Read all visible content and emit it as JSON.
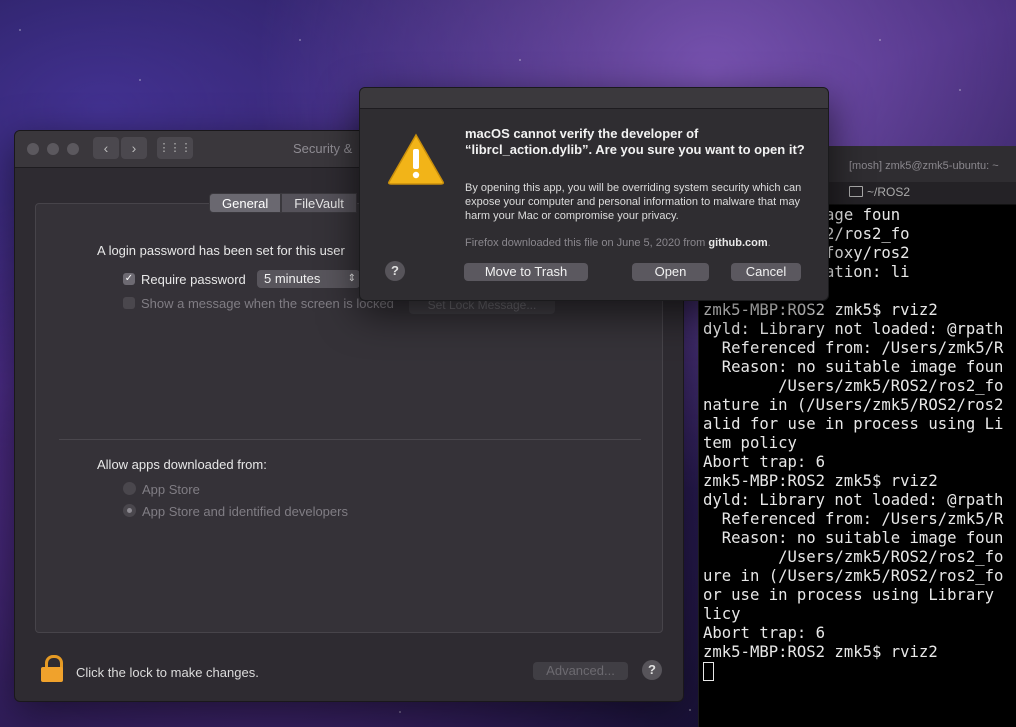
{
  "security_window": {
    "title": "Security &",
    "tabs": [
      "General",
      "FileVault"
    ],
    "login_text": "A login password has been set for this user",
    "require_password_label": "Require password",
    "require_password_value": "5 minutes",
    "show_message_label": "Show a message when the screen is locked",
    "set_lock_message_label": "Set Lock Message...",
    "allow_apps_label": "Allow apps downloaded from:",
    "option_app_store": "App Store",
    "option_identified": "App Store and identified developers",
    "lock_text": "Click the lock to make changes.",
    "advanced_label": "Advanced...",
    "help_label": "?"
  },
  "terminal": {
    "title": "[mosh] zmk5@zmk5-ubuntu: ~",
    "tab_label": "~/ROS2",
    "lines": [
      "  suitable image foun",
      "  /s/zmk5/ROS2/ros2_fo",
      "  /ROS2/ros2_foxy/ros2",
      "  brary Validation: li",
      "  6",
      "zmk5-MBP:ROS2 zmk5$ rviz2",
      "dyld: Library not loaded: @rpath",
      "  Referenced from: /Users/zmk5/R",
      "  Reason: no suitable image foun",
      "        /Users/zmk5/ROS2/ros2_fo",
      "nature in (/Users/zmk5/ROS2/ros2",
      "alid for use in process using Li",
      "tem policy",
      "Abort trap: 6",
      "zmk5-MBP:ROS2 zmk5$ rviz2",
      "dyld: Library not loaded: @rpath",
      "  Referenced from: /Users/zmk5/R",
      "  Reason: no suitable image foun",
      "        /Users/zmk5/ROS2/ros2_fo",
      "ure in (/Users/zmk5/ROS2/ros2_fo",
      "or use in process using Library",
      "licy",
      "Abort trap: 6",
      "zmk5-MBP:ROS2 zmk5$ rviz2"
    ]
  },
  "dialog": {
    "heading": "macOS cannot verify the developer of “librcl_action.dylib”. Are you sure you want to open it?",
    "body": "By opening this app, you will be overriding system security which can expose your computer and personal information to malware that may harm your Mac or compromise your privacy.",
    "source_prefix": "Firefox downloaded this file on June 5, 2020 from",
    "source_domain": "github.com",
    "source_suffix": ".",
    "help_label": "?",
    "move_to_trash_label": "Move to Trash",
    "open_label": "Open",
    "cancel_label": "Cancel"
  }
}
